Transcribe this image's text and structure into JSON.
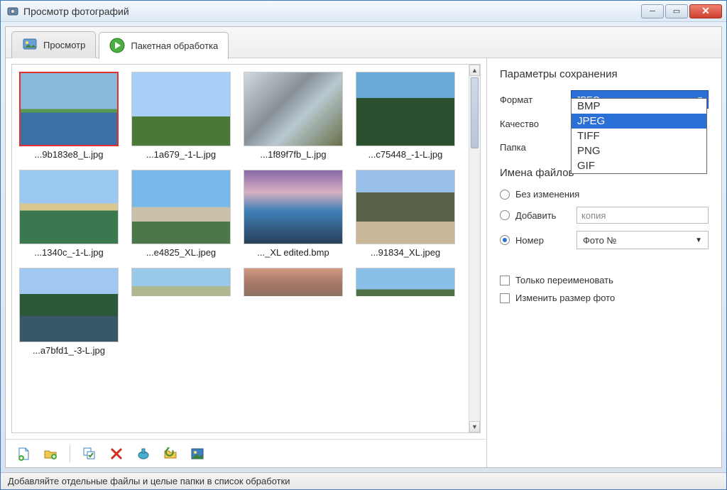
{
  "window": {
    "title": "Просмотр фотографий"
  },
  "tabs": {
    "view": "Просмотр",
    "batch": "Пакетная обработка"
  },
  "thumbs": [
    {
      "name": "...9b183e8_L.jpg",
      "selected": true,
      "cls": "fi1"
    },
    {
      "name": "...1a679_-1-L.jpg",
      "selected": false,
      "cls": "fi2"
    },
    {
      "name": "...1f89f7fb_L.jpg",
      "selected": false,
      "cls": "fi3"
    },
    {
      "name": "...c75448_-1-L.jpg",
      "selected": false,
      "cls": "fi4"
    },
    {
      "name": "...1340c_-1-L.jpg",
      "selected": false,
      "cls": "fi5"
    },
    {
      "name": "...e4825_XL.jpeg",
      "selected": false,
      "cls": "fi6"
    },
    {
      "name": "..._XL edited.bmp",
      "selected": false,
      "cls": "fi7"
    },
    {
      "name": "...91834_XL.jpeg",
      "selected": false,
      "cls": "fi8"
    },
    {
      "name": "...a7bfd1_-3-L.jpg",
      "selected": false,
      "cls": "fi9"
    }
  ],
  "side": {
    "save_params": "Параметры сохранения",
    "format_label": "Формат",
    "format_value": "JPEG",
    "format_options": [
      "BMP",
      "JPEG",
      "TIFF",
      "PNG",
      "GIF"
    ],
    "quality_label": "Качество",
    "folder_label": "Папка",
    "filenames": "Имена файлов",
    "no_change": "Без изменения",
    "add_label": "Добавить",
    "add_placeholder": "копия",
    "number_label": "Номер",
    "number_value": "Фото №",
    "rename_only": "Только переименовать",
    "resize": "Изменить размер фото"
  },
  "status": "Добавляйте отдельные файлы и целые папки в список обработки"
}
